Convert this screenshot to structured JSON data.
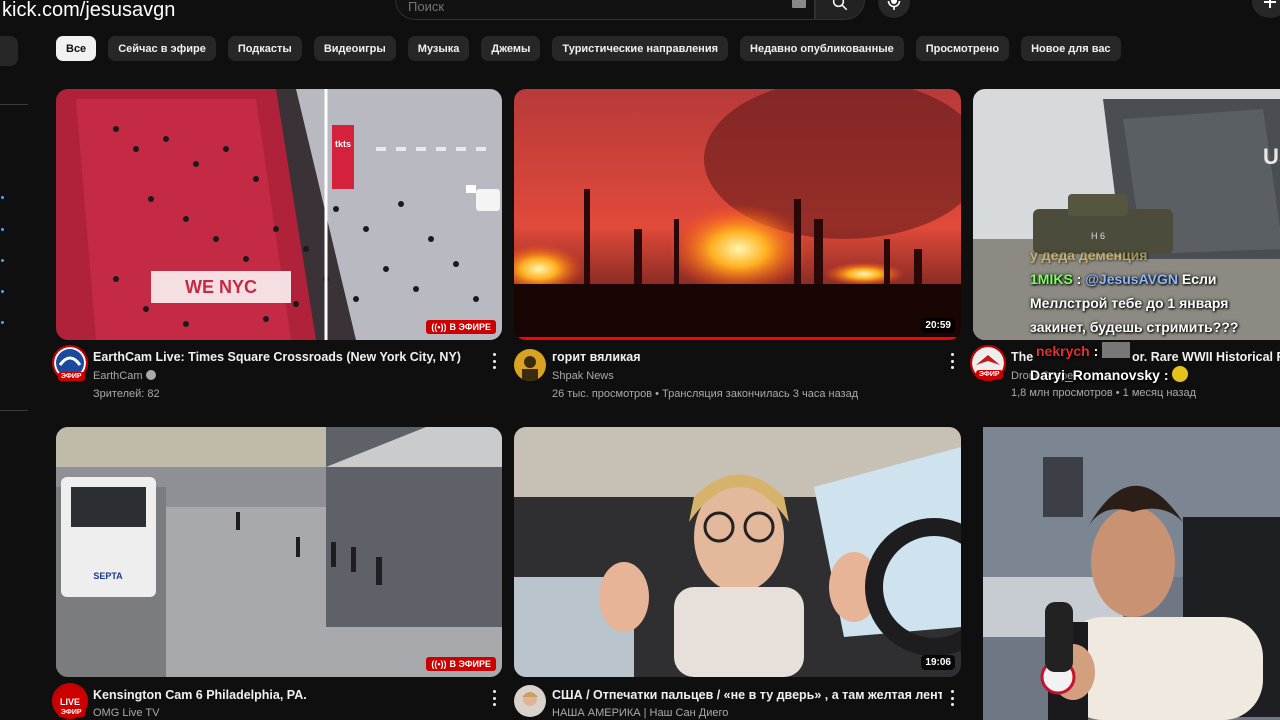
{
  "overlay": {
    "watermark": "kick.com/jesusavgn"
  },
  "header": {
    "search_placeholder": "Поиск"
  },
  "chips": [
    "Все",
    "Сейчас в эфире",
    "Подкасты",
    "Видеоигры",
    "Музыка",
    "Джемы",
    "Туристические направления",
    "Недавно опубликованные",
    "Просмотрено",
    "Новое для вас"
  ],
  "videos": [
    {
      "title": "EarthCam Live:  Times Square Crossroads (New York City, NY)",
      "channel": "EarthCam",
      "verified": true,
      "stats": "Зрителей: 82",
      "badge": "В ЭФИРЕ",
      "avatar_badge": "ЭФИР"
    },
    {
      "title": "горит вяликая",
      "channel": "Shpak News",
      "stats": "26 тыс. просмотров • Трансляция закончилась 3 часа назад",
      "duration": "20:59"
    },
    {
      "title": "The R",
      "title_tail": "or. Rare WWII Historical Fo",
      "channel": "Drone",
      "channel_tail": "Scape",
      "stats": "1,8 млн просмотров • 1 месяц назад",
      "avatar_badge": "ЭФИР"
    },
    {
      "title": "Kensington Cam 6 Philadelphia, PA.",
      "channel": "OMG Live TV",
      "badge": "В ЭФИРЕ",
      "avatar_badge": "ЭФИР"
    },
    {
      "title": "США / Отпечатки пальцев /  «не в ту дверь» , а там желтая лента",
      "channel": "НАША АМЕРИКА | Наш Сан Диего",
      "duration": "19:06"
    }
  ],
  "thumb_text": {
    "tkts": "tkts",
    "we_nyc": "WE NYC",
    "septa": "SEPTA",
    "us": "US",
    "h6": "H 6"
  },
  "chat": [
    {
      "user": "",
      "text": "у деда деменция"
    },
    {
      "user": "1MIKS",
      "sep": " : ",
      "mention": "@JesusAVGN",
      "text": " Если"
    },
    {
      "user": "",
      "text": "Меллстрой тебе до 1 января"
    },
    {
      "user": "",
      "text": "закинет, будешь стримить???"
    },
    {
      "user": "nekrych",
      "sep": " : ",
      "text": ""
    },
    {
      "user": "Daryi_Romanovsky",
      "sep": " : ",
      "text": ""
    }
  ]
}
